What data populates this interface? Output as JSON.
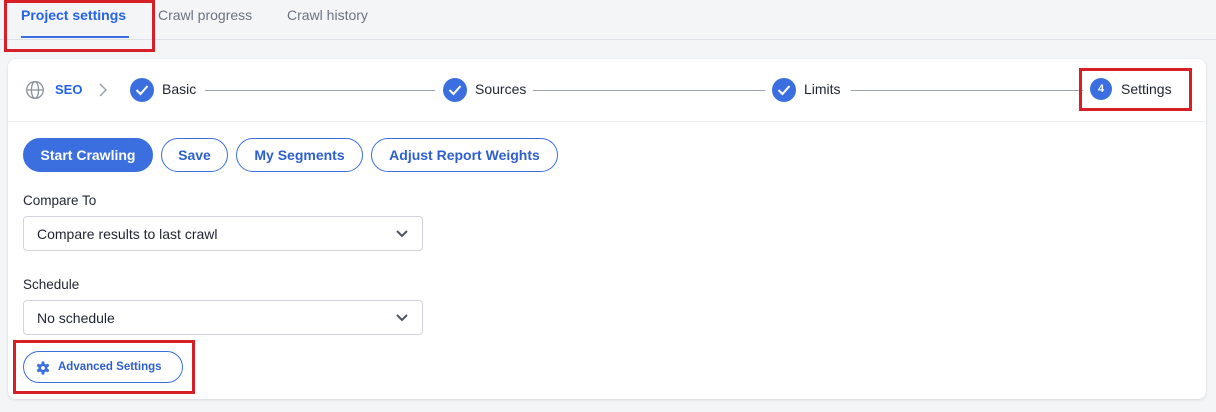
{
  "tabs": [
    {
      "label": "Project settings",
      "active": true
    },
    {
      "label": "Crawl progress",
      "active": false
    },
    {
      "label": "Crawl history",
      "active": false
    }
  ],
  "stepper": {
    "root": {
      "label": "SEO",
      "icon": "globe-icon"
    },
    "steps": [
      {
        "label": "Basic",
        "state": "done"
      },
      {
        "label": "Sources",
        "state": "done"
      },
      {
        "label": "Limits",
        "state": "done"
      },
      {
        "label": "Settings",
        "number": "4",
        "state": "current"
      }
    ]
  },
  "actions": {
    "start_crawling": "Start Crawling",
    "save": "Save",
    "my_segments": "My Segments",
    "adjust_report_weights": "Adjust Report Weights"
  },
  "compare_to": {
    "label": "Compare To",
    "value": "Compare results to last crawl"
  },
  "schedule": {
    "label": "Schedule",
    "value": "No schedule"
  },
  "advanced_settings": {
    "label": "Advanced Settings",
    "icon": "gear-icon"
  },
  "colors": {
    "accent": "#3b6fe0",
    "highlight": "#d61f26"
  }
}
